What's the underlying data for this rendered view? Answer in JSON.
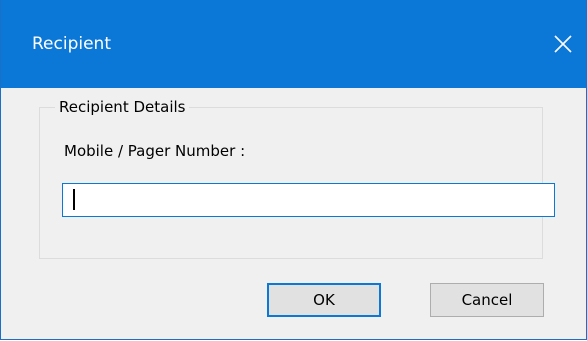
{
  "window": {
    "title": "Recipient",
    "close_glyph": "✕",
    "accent_color": "#0b78d7"
  },
  "group": {
    "legend": "Recipient Details",
    "field_label": "Mobile / Pager Number :",
    "input_value": ""
  },
  "buttons": {
    "ok_label": "OK",
    "cancel_label": "Cancel"
  },
  "icons": {
    "close": "close-icon"
  }
}
